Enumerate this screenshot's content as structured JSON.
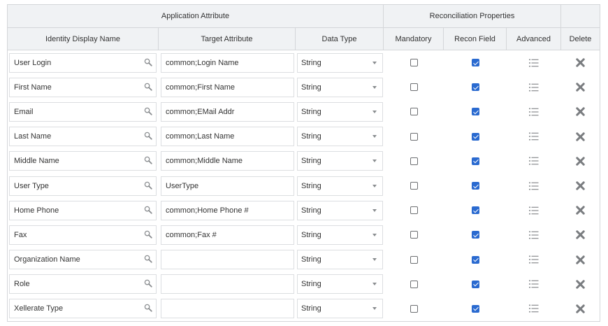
{
  "header": {
    "group_application_attribute": "Application Attribute",
    "group_reconciliation_properties": "Reconciliation Properties",
    "col_identity_display_name": "Identity Display Name",
    "col_target_attribute": "Target Attribute",
    "col_data_type": "Data Type",
    "col_mandatory": "Mandatory",
    "col_recon_field": "Recon Field",
    "col_advanced": "Advanced",
    "col_delete": "Delete"
  },
  "icons": {
    "search": "search-icon",
    "dropdown": "chevron-down-icon",
    "advanced": "list-icon",
    "delete": "close-icon"
  },
  "colors": {
    "accent": "#2a6ad0",
    "delete": "#7a7d80",
    "header_bg": "#f0f2f4"
  },
  "rows": [
    {
      "identity": "User Login",
      "target": "common;Login Name",
      "type": "String",
      "mandatory": false,
      "recon": true
    },
    {
      "identity": "First Name",
      "target": "common;First Name",
      "type": "String",
      "mandatory": false,
      "recon": true
    },
    {
      "identity": "Email",
      "target": "common;EMail Addr",
      "type": "String",
      "mandatory": false,
      "recon": true
    },
    {
      "identity": "Last Name",
      "target": "common;Last Name",
      "type": "String",
      "mandatory": false,
      "recon": true
    },
    {
      "identity": "Middle Name",
      "target": "common;Middle Name",
      "type": "String",
      "mandatory": false,
      "recon": true
    },
    {
      "identity": "User Type",
      "target": "UserType",
      "type": "String",
      "mandatory": false,
      "recon": true
    },
    {
      "identity": "Home Phone",
      "target": "common;Home Phone #",
      "type": "String",
      "mandatory": false,
      "recon": true
    },
    {
      "identity": "Fax",
      "target": "common;Fax #",
      "type": "String",
      "mandatory": false,
      "recon": true
    },
    {
      "identity": "Organization Name",
      "target": "",
      "type": "String",
      "mandatory": false,
      "recon": true
    },
    {
      "identity": "Role",
      "target": "",
      "type": "String",
      "mandatory": false,
      "recon": true
    },
    {
      "identity": "Xellerate Type",
      "target": "",
      "type": "String",
      "mandatory": false,
      "recon": true
    }
  ]
}
